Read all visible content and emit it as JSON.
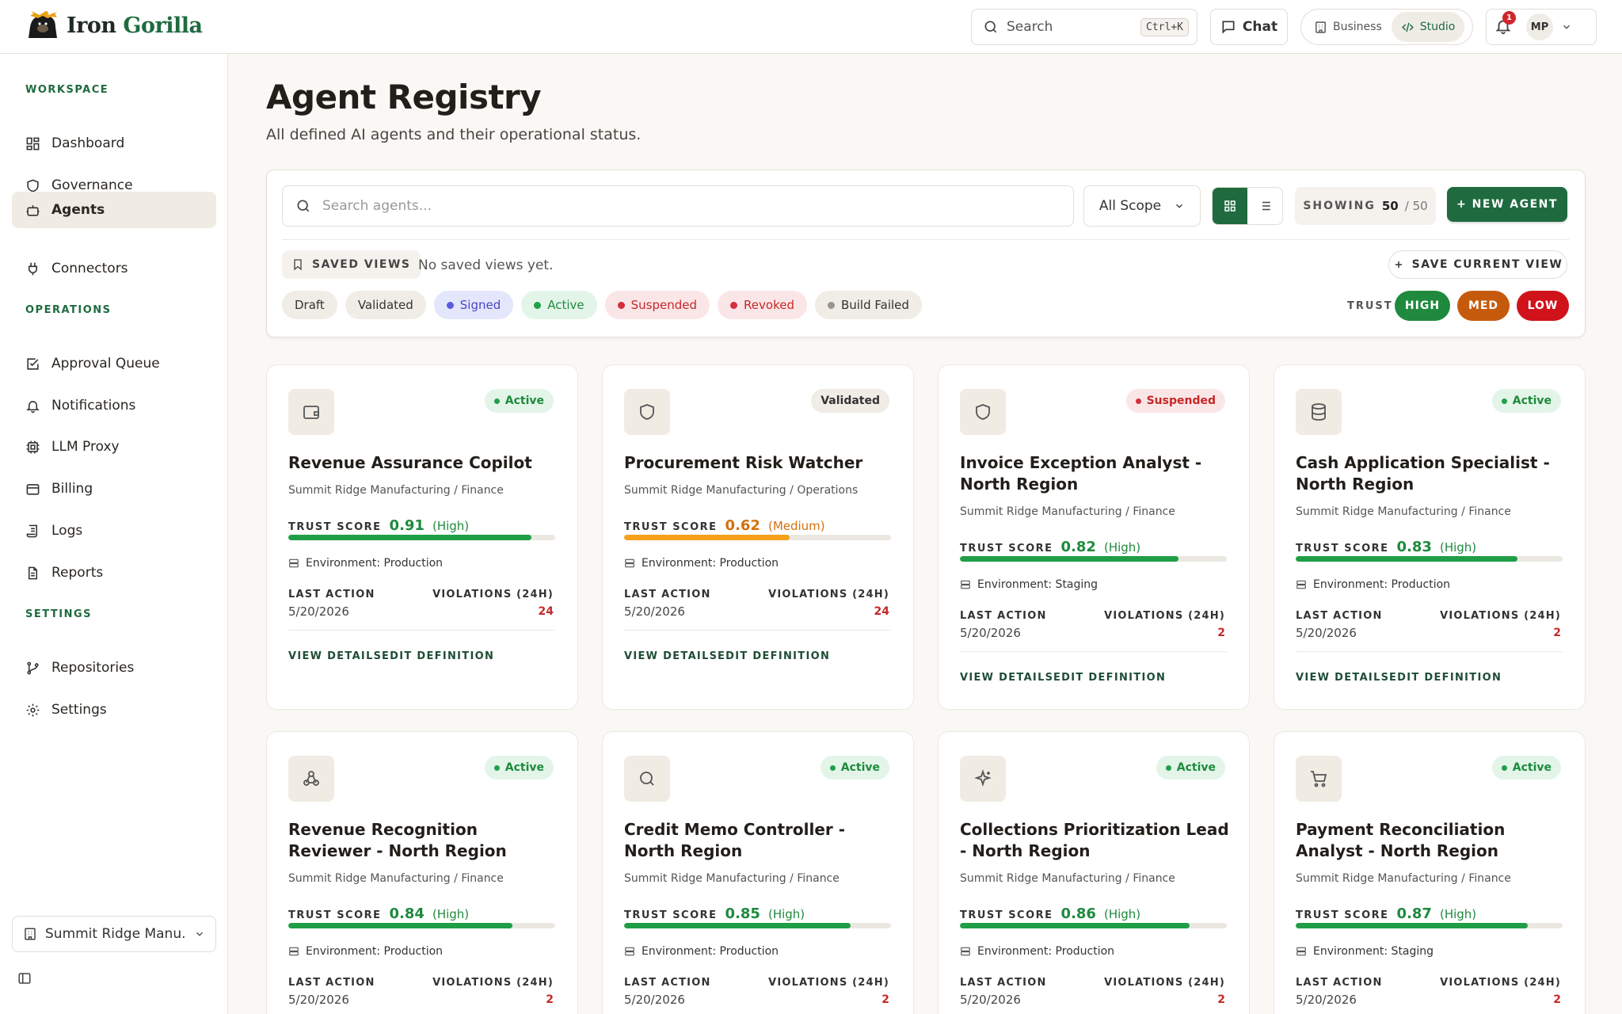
{
  "app": {
    "brand_1": "Iron",
    "brand_2": "Gorilla"
  },
  "topbar": {
    "search_label": "Search",
    "search_shortcut": "Ctrl+K",
    "chat_label": "Chat",
    "mode_business": "Business",
    "mode_studio": "Studio",
    "notif_count": "1",
    "user_initials": "MP"
  },
  "sidebar": {
    "workspace_header": "WORKSPACE",
    "operations_header": "OPERATIONS",
    "settings_header": "SETTINGS",
    "items": [
      {
        "label": "Dashboard"
      },
      {
        "label": "Governance"
      },
      {
        "label": "Agents"
      },
      {
        "label": "Connectors"
      },
      {
        "label": "Approval Queue"
      },
      {
        "label": "Notifications"
      },
      {
        "label": "LLM Proxy"
      },
      {
        "label": "Billing"
      },
      {
        "label": "Logs"
      },
      {
        "label": "Reports"
      },
      {
        "label": "Repositories"
      },
      {
        "label": "Settings"
      }
    ],
    "org_selector": "Summit Ridge Manu..."
  },
  "page": {
    "title": "Agent Registry",
    "subtitle": "All defined AI agents and their operational status."
  },
  "toolbar": {
    "search_placeholder": "Search agents...",
    "scope_value": "All Scope",
    "showing_label": "SHOWING",
    "showing_count": "50",
    "showing_total": "/ 50",
    "new_agent_label": "+ NEW AGENT",
    "saved_views_label": "SAVED VIEWS",
    "no_saved_views": "No saved views yet.",
    "save_current_view_label": "SAVE CURRENT VIEW",
    "trust_label": "TRUST",
    "trust_high": "HIGH",
    "trust_med": "MED",
    "trust_low": "LOW"
  },
  "status_chips": [
    {
      "label": "Draft",
      "dot": ""
    },
    {
      "label": "Validated",
      "dot": ""
    },
    {
      "label": "Signed",
      "dot": "#5b5be0"
    },
    {
      "label": "Active",
      "dot": "#22a04a"
    },
    {
      "label": "Suspended",
      "dot": "#d32f3f"
    },
    {
      "label": "Revoked",
      "dot": "#d32f3f"
    },
    {
      "label": "Build Failed",
      "dot": "#9a948c"
    }
  ],
  "card_labels": {
    "trust_score": "TRUST SCORE",
    "last_action": "LAST ACTION",
    "violations": "VIOLATIONS (24H)",
    "view_details": "VIEW DETAILS",
    "edit_definition": "EDIT DEFINITION"
  },
  "agents": [
    {
      "icon": "wallet-icon",
      "status": "Active",
      "title": "Revenue Assurance Copilot",
      "subtitle": "Summit Ridge Manufacturing / Finance",
      "trust": 0.91,
      "trust_text": "0.91",
      "trust_level": "(High)",
      "environment": "Environment: Production",
      "last_action": "5/20/2026",
      "violations": "24"
    },
    {
      "icon": "shield-icon",
      "status": "Validated",
      "title": "Procurement Risk Watcher",
      "subtitle": "Summit Ridge Manufacturing / Operations",
      "trust": 0.62,
      "trust_text": "0.62",
      "trust_level": "(Medium)",
      "environment": "Environment: Production",
      "last_action": "5/20/2026",
      "violations": "24"
    },
    {
      "icon": "shield-icon",
      "status": "Suspended",
      "title": "Invoice Exception Analyst - North Region",
      "subtitle": "Summit Ridge Manufacturing / Finance",
      "trust": 0.82,
      "trust_text": "0.82",
      "trust_level": "(High)",
      "environment": "Environment: Staging",
      "last_action": "5/20/2026",
      "violations": "2"
    },
    {
      "icon": "database-icon",
      "status": "Active",
      "title": "Cash Application Specialist - North Region",
      "subtitle": "Summit Ridge Manufacturing / Finance",
      "trust": 0.83,
      "trust_text": "0.83",
      "trust_level": "(High)",
      "environment": "Environment: Production",
      "last_action": "5/20/2026",
      "violations": "2"
    },
    {
      "icon": "webhook-icon",
      "status": "Active",
      "title": "Revenue Recognition Reviewer - North Region",
      "subtitle": "Summit Ridge Manufacturing / Finance",
      "trust": 0.84,
      "trust_text": "0.84",
      "trust_level": "(High)",
      "environment": "Environment: Production",
      "last_action": "5/20/2026",
      "violations": "2"
    },
    {
      "icon": "search-icon",
      "status": "Active",
      "title": "Credit Memo Controller - North Region",
      "subtitle": "Summit Ridge Manufacturing / Finance",
      "trust": 0.85,
      "trust_text": "0.85",
      "trust_level": "(High)",
      "environment": "Environment: Production",
      "last_action": "5/20/2026",
      "violations": "2"
    },
    {
      "icon": "sparkles-icon",
      "status": "Active",
      "title": "Collections Prioritization Lead - North Region",
      "subtitle": "Summit Ridge Manufacturing / Finance",
      "trust": 0.86,
      "trust_text": "0.86",
      "trust_level": "(High)",
      "environment": "Environment: Production",
      "last_action": "5/20/2026",
      "violations": "2"
    },
    {
      "icon": "cart-icon",
      "status": "Active",
      "title": "Payment Reconciliation Analyst - North Region",
      "subtitle": "Summit Ridge Manufacturing / Finance",
      "trust": 0.87,
      "trust_text": "0.87",
      "trust_level": "(High)",
      "environment": "Environment: Staging",
      "last_action": "5/20/2026",
      "violations": "2"
    }
  ],
  "colors": {
    "brand": "#1f6b3f",
    "high": "#1f9e47",
    "medium": "#f5a11c",
    "low": "#c62828",
    "active_text": "#1f8a3e",
    "suspended_text": "#c62828"
  }
}
